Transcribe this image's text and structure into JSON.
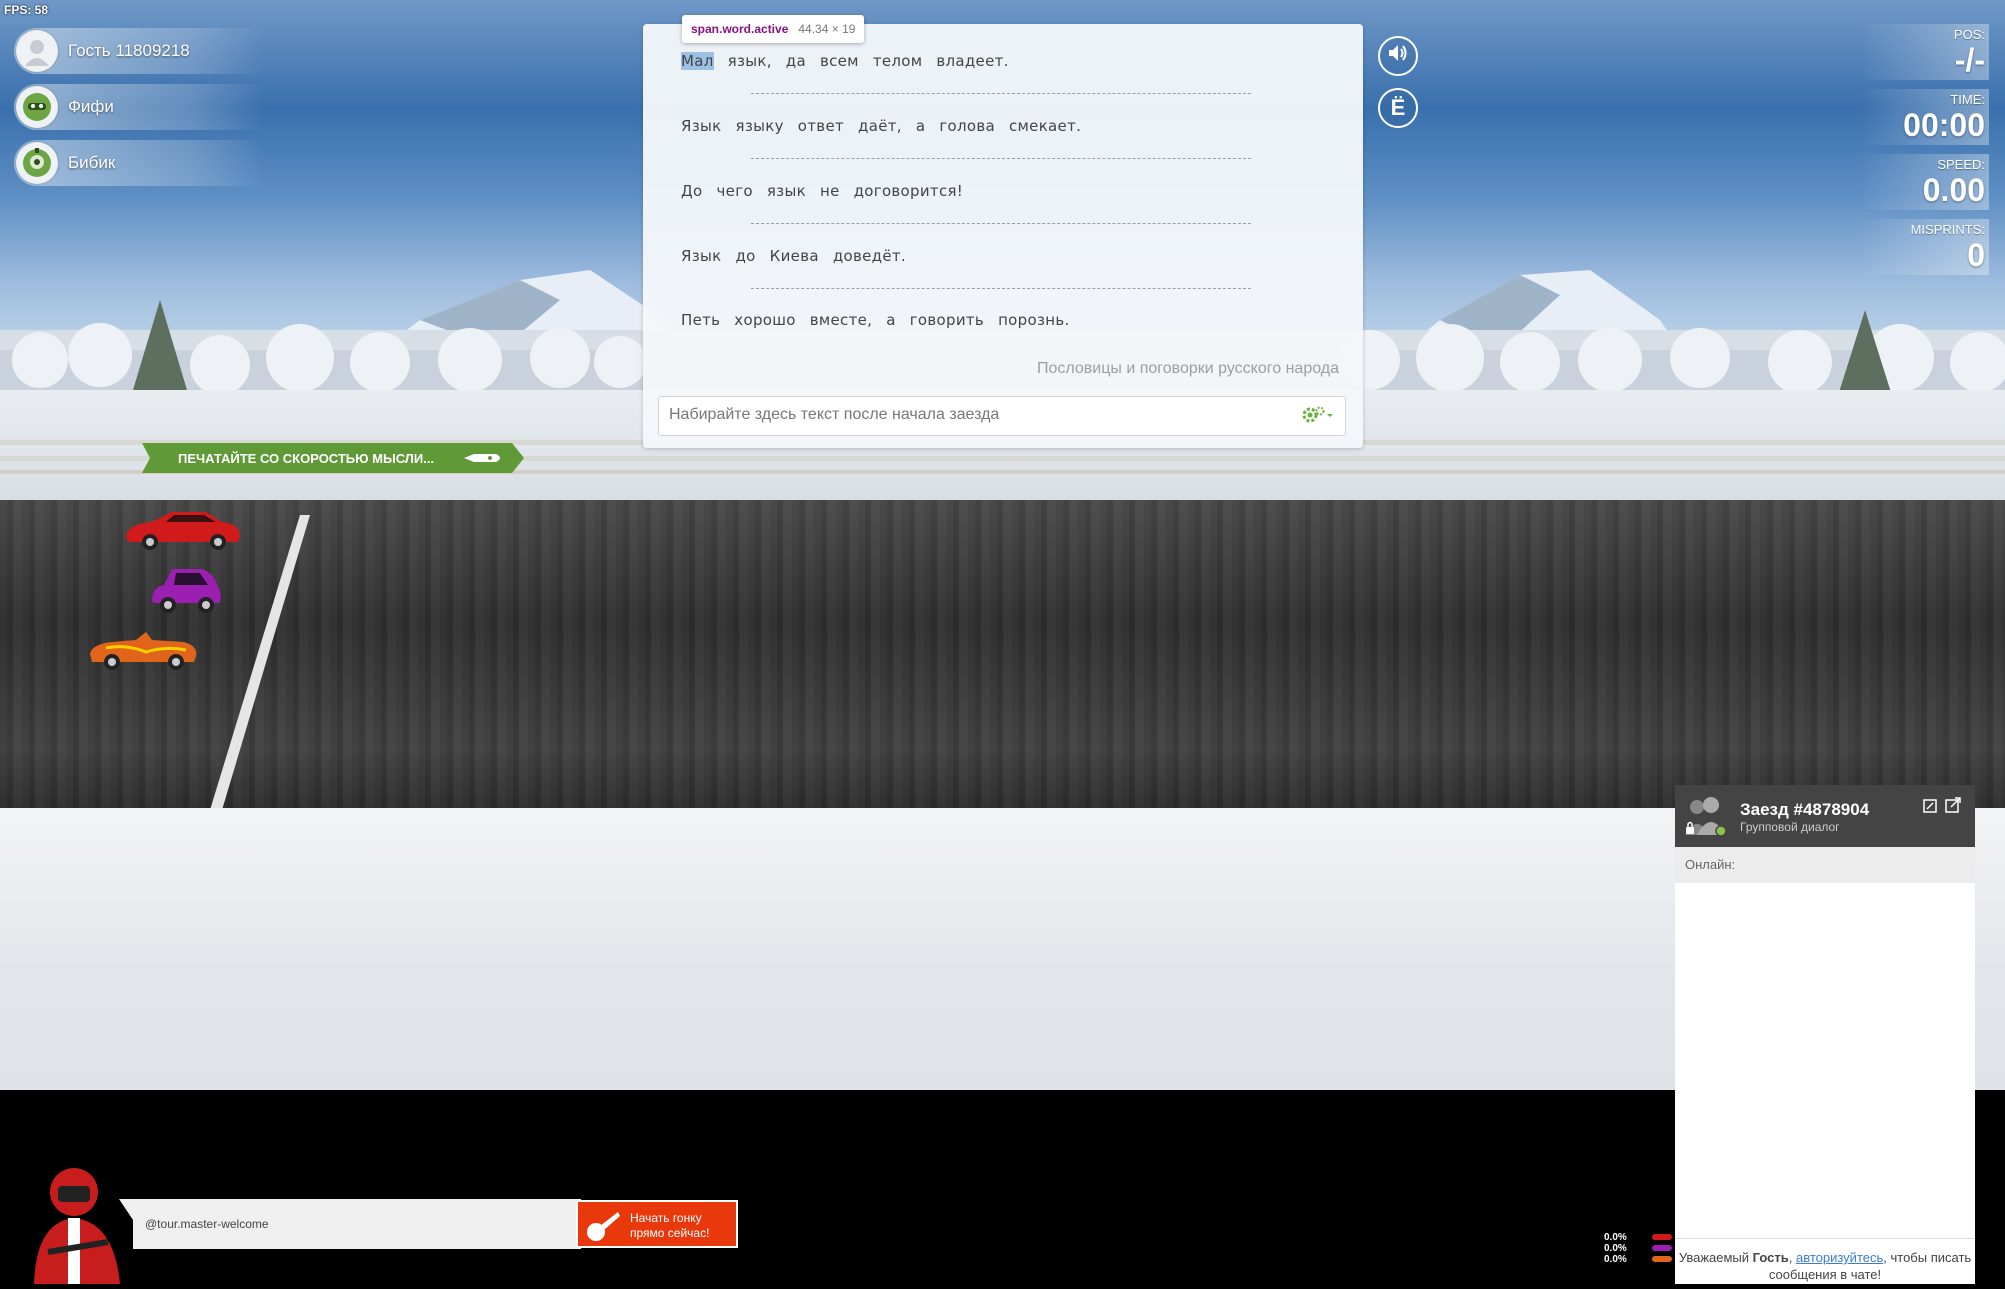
{
  "fps": "FPS: 58",
  "players": [
    {
      "name": "Гость 11809218",
      "avatar": "guest-avatar"
    },
    {
      "name": "Фифи",
      "avatar": "green-bot-avatar"
    },
    {
      "name": "Бибик",
      "avatar": "green-robot-avatar"
    }
  ],
  "tooltip": {
    "selector": "span.word.active",
    "size": "44.34 × 19"
  },
  "text_lines": [
    [
      "Мал",
      "язык,",
      "да",
      "всем",
      "телом",
      "владеет."
    ],
    [
      "Язык",
      "языку",
      "ответ",
      "даёт,",
      "а",
      "голова",
      "смекает."
    ],
    [
      "До",
      "чего",
      "язык",
      "не",
      "договорится!"
    ],
    [
      "Язык",
      "до",
      "Киева",
      "доведёт."
    ],
    [
      "Петь",
      "хорошо",
      "вместе,",
      "а",
      "говорить",
      "порознь."
    ]
  ],
  "source": "Пословицы и поговорки русского народа",
  "input_placeholder": "Набирайте здесь текст после начала заезда",
  "yo_button": "Ё",
  "stats": {
    "pos_label": "POS:",
    "pos_value": "-/-",
    "time_label": "TIME:",
    "time_value": "00:00",
    "speed_label": "SPEED:",
    "speed_value": "0.00",
    "misprints_label": "MISPRINTS:",
    "misprints_value": "0"
  },
  "banner": "ПЕЧАТАЙТЕ СО СКОРОСТЬЮ МЫСЛИ...",
  "cars": [
    {
      "color": "#d11a1a",
      "name": "red-car"
    },
    {
      "color": "#9b1fb0",
      "name": "purple-car"
    },
    {
      "color": "#e0641a",
      "name": "orange-car"
    }
  ],
  "chat": {
    "title": "Заезд #4878904",
    "subtitle": "Групповой диалог",
    "online_label": "Онлайн:",
    "footer_pre": "Уважаемый ",
    "footer_bold": "Гость",
    "footer_sep": ", ",
    "footer_link": "авторизуйтесь",
    "footer_post": ", чтобы писать сообщения в чате!"
  },
  "welcome_text": "@tour.master-welcome",
  "start_button": {
    "line1": "Начать гонку",
    "line2": "прямо сейчас!"
  },
  "mini_progress": [
    "0.0%",
    "0.0%",
    "0.0%"
  ]
}
